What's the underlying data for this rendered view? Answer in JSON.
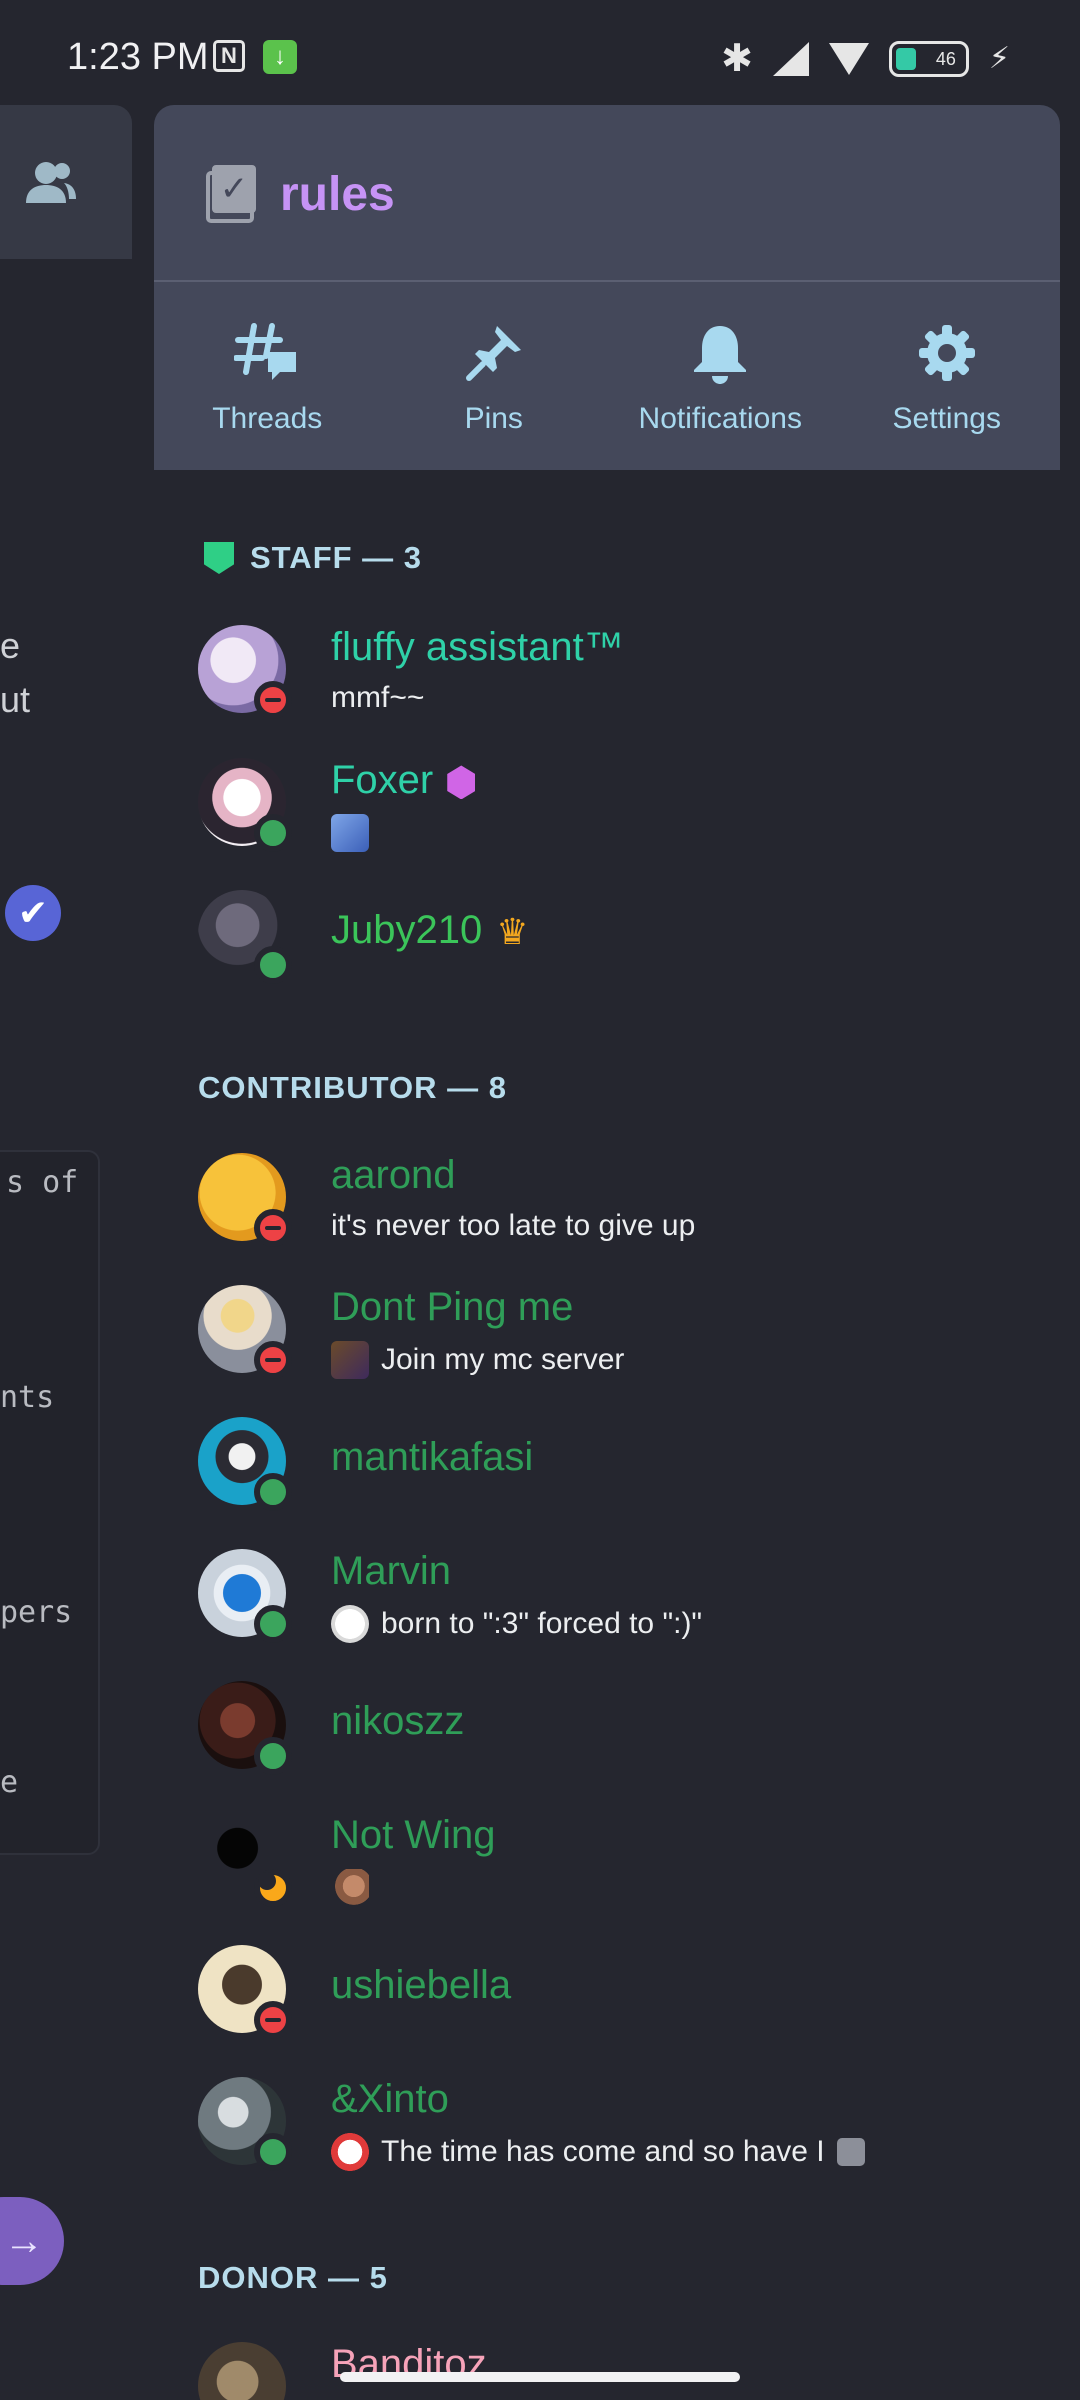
{
  "status_bar": {
    "time": "1:23 PM",
    "battery": "46"
  },
  "background_peek": {
    "text_lines": [
      "e",
      "ut"
    ],
    "mono_lines": [
      "s of",
      "nts",
      "pers",
      "e"
    ]
  },
  "channel": {
    "name": "rules",
    "actions": [
      {
        "label": "Threads",
        "icon": "threads-icon"
      },
      {
        "label": "Pins",
        "icon": "pin-icon"
      },
      {
        "label": "Notifications",
        "icon": "bell-icon"
      },
      {
        "label": "Settings",
        "icon": "gear-icon"
      }
    ]
  },
  "sections": [
    {
      "title": "STAFF — 3"
    },
    {
      "title": "CONTRIBUTOR — 8"
    },
    {
      "title": "DONOR — 5"
    }
  ],
  "members": [
    {
      "name": "fluffy assistant™",
      "status_text": "mmf~~",
      "status": "dnd",
      "color": "#2fd1a8"
    },
    {
      "name": "Foxer",
      "status_text": "",
      "status": "online",
      "color": "#2fd1a8"
    },
    {
      "name": "Juby210",
      "status_text": "",
      "status": "online",
      "color": "#3bc55a"
    },
    {
      "name": "aarond",
      "status_text": "it's never too late to give up",
      "status": "dnd",
      "color": "#2f9e58"
    },
    {
      "name": "Dont Ping me",
      "status_text": "Join my mc server",
      "status": "dnd",
      "color": "#2f9e58"
    },
    {
      "name": "mantikafasi",
      "status_text": "",
      "status": "online",
      "color": "#2f9e58"
    },
    {
      "name": "Marvin",
      "status_text": "born to \":3\" forced to \":)\"",
      "status": "online",
      "color": "#2f9e58"
    },
    {
      "name": "nikoszz",
      "status_text": "",
      "status": "online",
      "color": "#2f9e58"
    },
    {
      "name": "Not Wing",
      "status_text": "",
      "status": "idle",
      "color": "#2f9e58"
    },
    {
      "name": "ushiebella",
      "status_text": "",
      "status": "dnd",
      "color": "#2f9e58"
    },
    {
      "name": "&Xinto",
      "status_text": "The time has come and so have I",
      "status": "online",
      "color": "#2f9e58"
    },
    {
      "name": "Banditoz",
      "status_text": "",
      "status": "",
      "color": "#f6a3b9"
    }
  ]
}
